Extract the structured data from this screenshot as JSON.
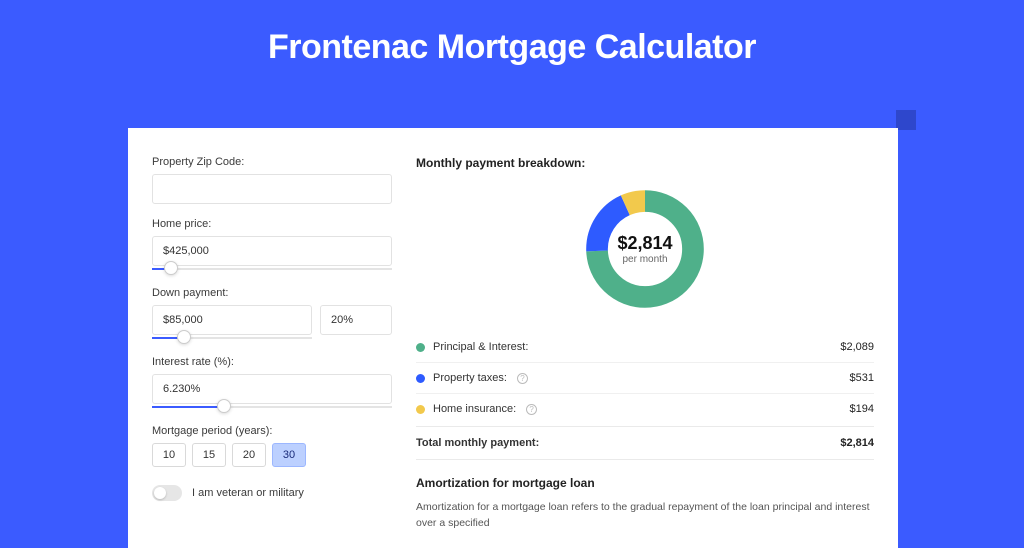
{
  "title": "Frontenac Mortgage Calculator",
  "form": {
    "zip": {
      "label": "Property Zip Code:",
      "value": ""
    },
    "home_price": {
      "label": "Home price:",
      "value": "$425,000",
      "slider_pct": 8
    },
    "down_payment": {
      "label": "Down payment:",
      "amount": "$85,000",
      "pct": "20%",
      "slider_pct": 20
    },
    "interest_rate": {
      "label": "Interest rate (%):",
      "value": "6.230%",
      "slider_pct": 30
    },
    "period": {
      "label": "Mortgage period (years):",
      "options": [
        "10",
        "15",
        "20",
        "30"
      ],
      "selected_index": 3
    },
    "veteran": {
      "label": "I am veteran or military",
      "checked": false
    }
  },
  "breakdown": {
    "heading": "Monthly payment breakdown:",
    "center_amount": "$2,814",
    "center_sub": "per month",
    "items": [
      {
        "label": "Principal & Interest:",
        "value": "$2,089",
        "color": "#4fb08a",
        "info": false
      },
      {
        "label": "Property taxes:",
        "value": "$531",
        "color": "#2e5bff",
        "info": true
      },
      {
        "label": "Home insurance:",
        "value": "$194",
        "color": "#f2c94c",
        "info": true
      }
    ],
    "total_label": "Total monthly payment:",
    "total_value": "$2,814"
  },
  "amort": {
    "heading": "Amortization for mortgage loan",
    "text": "Amortization for a mortgage loan refers to the gradual repayment of the loan principal and interest over a specified"
  },
  "chart_data": {
    "type": "pie",
    "title": "Monthly payment breakdown",
    "series": [
      {
        "name": "Principal & Interest",
        "value": 2089,
        "color": "#4fb08a"
      },
      {
        "name": "Property taxes",
        "value": 531,
        "color": "#2e5bff"
      },
      {
        "name": "Home insurance",
        "value": 194,
        "color": "#f2c94c"
      }
    ],
    "total": 2814,
    "unit": "USD per month"
  }
}
